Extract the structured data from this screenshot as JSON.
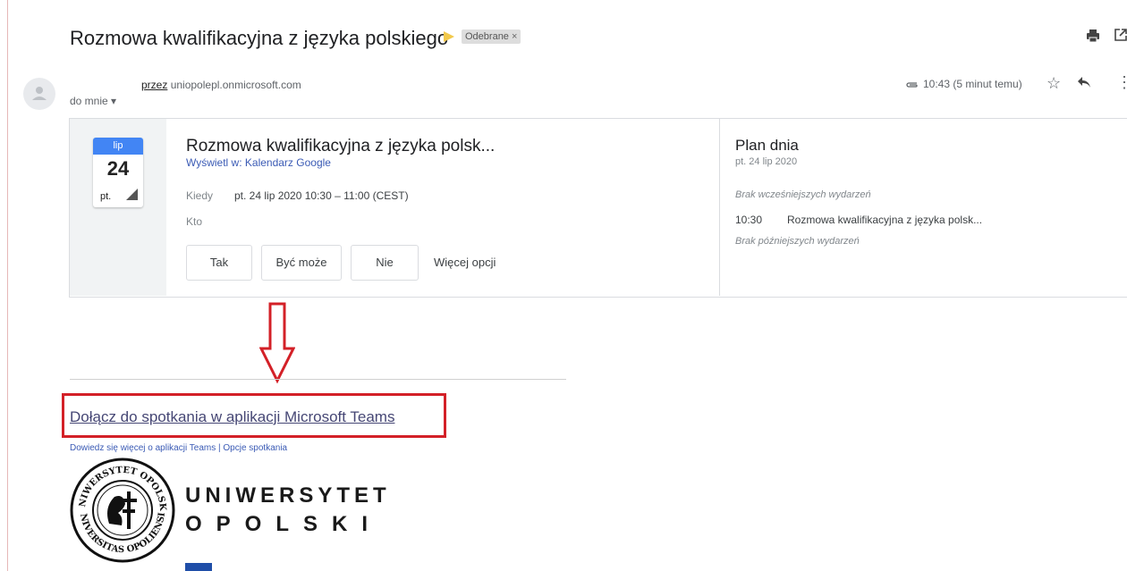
{
  "email": {
    "subject": "Rozmowa kwalifikacyjna z języka polskiego",
    "label": "Odebrane",
    "label_close": "×",
    "sender_via_prefix": "przez",
    "sender_domain": "uniopolepl.onmicrosoft.com",
    "to_me": "do mnie ▾",
    "time": "10:43 (5 minut temu)"
  },
  "invite": {
    "month": "lip",
    "day": "24",
    "weekday": "pt.",
    "title": "Rozmowa kwalifikacyjna z języka polsk...",
    "view_link": "Wyświetl w: Kalendarz Google",
    "when_label": "Kiedy",
    "when_value": "pt. 24 lip 2020 10:30 – 11:00 (CEST)",
    "who_label": "Kto",
    "btn_yes": "Tak",
    "btn_maybe": "Być może",
    "btn_no": "Nie",
    "more_options": "Więcej opcji"
  },
  "agenda": {
    "title": "Plan dnia",
    "date": "pt. 24 lip 2020",
    "no_earlier": "Brak wcześniejszych wydarzeń",
    "event_time": "10:30",
    "event_title": "Rozmowa kwalifikacyjna z języka polsk...",
    "no_later": "Brak późniejszych wydarzeń"
  },
  "body": {
    "teams_link": "Dołącz do spotkania w aplikacji Microsoft Teams",
    "learn_more": "Dowiedz się więcej o aplikacji Teams",
    "separator": "|",
    "meeting_options": "Opcje spotkania"
  },
  "logo": {
    "line1": "UNIWERSYTET",
    "line2": "OPOLSKI",
    "seal_text_top": "UNIWERSYTET OPOLSKI",
    "seal_text_bottom": "UNIVERSITAS OPOLIENSIS"
  },
  "icons": {
    "print": "print-icon",
    "popout": "popout-icon",
    "avatar": "person-icon",
    "attachment": "paperclip-icon",
    "star": "star-icon",
    "reply": "reply-icon",
    "more": "more-vert-icon",
    "arrow": "down-arrow-icon"
  },
  "colors": {
    "calendar_blue": "#4285f4",
    "highlight_red": "#d32027",
    "teams_purple": "#464775",
    "link_blue": "#3b5bb5",
    "important_yellow": "#f2c94c"
  }
}
